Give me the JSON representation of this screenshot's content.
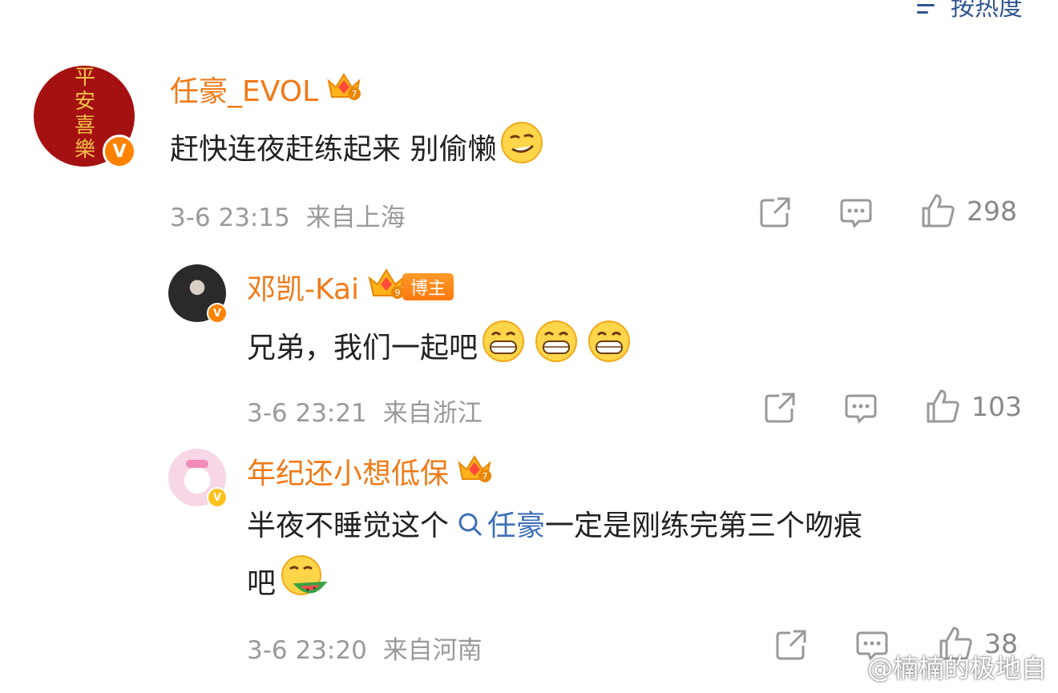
{
  "sort": {
    "label": "按热度",
    "icon": "sort-lines-icon"
  },
  "comments": [
    {
      "username": "任豪_EVOL",
      "avatar_text": [
        "平",
        "安",
        "喜",
        "樂"
      ],
      "badge": "crown-7-icon",
      "content": "赶快连夜赶练起来 别偷懒",
      "emoji": "smirk-emoji",
      "timestamp": "3-6 23:15",
      "location": "来自上海",
      "like_count": "298"
    },
    {
      "username": "邓凯-Kai",
      "badge": "crown-9-icon",
      "tag": "博主",
      "content": "兄弟，我们一起吧",
      "emojis": [
        "grin-emoji",
        "grin-emoji",
        "grin-emoji"
      ],
      "timestamp": "3-6 23:21",
      "location": "来自浙江",
      "like_count": "103"
    },
    {
      "username": "年纪还小想低保",
      "badge": "crown-7-icon",
      "content_before": "半夜不睡觉这个",
      "link_text": "任豪",
      "content_after": "一定是刚练完第三个吻痕",
      "content_line2": "吧",
      "emoji": "eating-watermelon-emoji",
      "timestamp": "3-6 23:20",
      "location": "来自河南",
      "like_count": "38"
    }
  ],
  "verified_mark": "V",
  "watermark": {
    "text": "@楠楠的极地自",
    "icon": "weibo-logo-icon"
  },
  "colors": {
    "username": "#f07a18",
    "link": "#3d6fb6",
    "meta": "#9a9a9a",
    "verified": "#ff8200"
  }
}
